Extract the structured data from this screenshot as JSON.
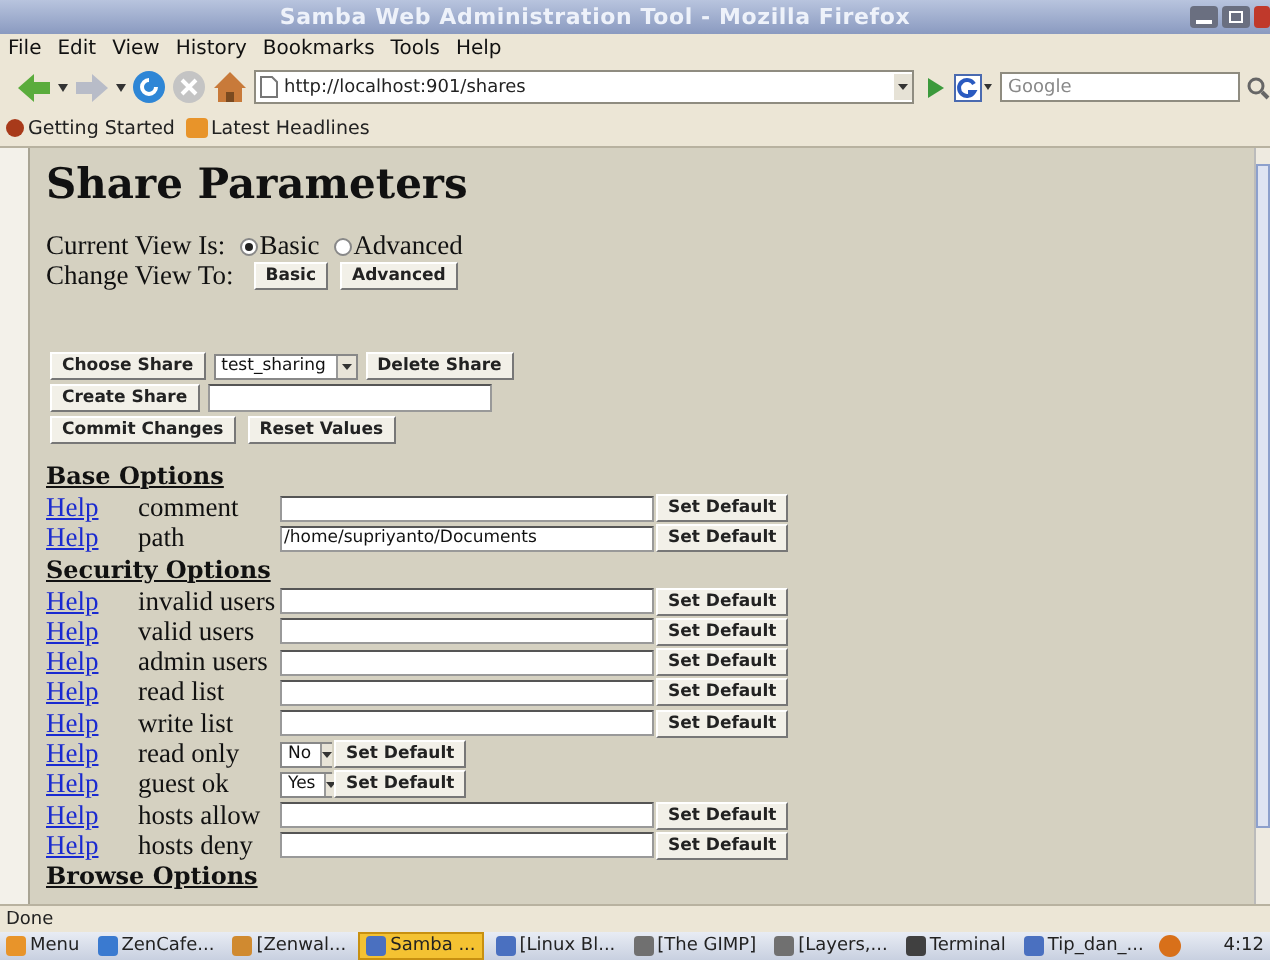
{
  "window": {
    "title": "Samba Web Administration Tool - Mozilla Firefox"
  },
  "menu": [
    "File",
    "Edit",
    "View",
    "History",
    "Bookmarks",
    "Tools",
    "Help"
  ],
  "address": {
    "value": "http://localhost:901/shares"
  },
  "search": {
    "placeholder": "Google"
  },
  "bookmarks": [
    "Getting Started",
    "Latest Headlines"
  ],
  "page": {
    "heading": "Share Parameters",
    "current_view_label": "Current View Is:",
    "view_options": [
      {
        "label": "Basic",
        "selected": true
      },
      {
        "label": "Advanced",
        "selected": false
      }
    ],
    "change_view_label": "Change View To:",
    "view_buttons": [
      "Basic",
      "Advanced"
    ],
    "choose_share_button": "Choose Share",
    "share_select": {
      "value": "test_sharing"
    },
    "delete_button": "Delete Share",
    "create_button": "Create Share",
    "commit_button": "Commit Changes",
    "reset_button": "Reset Values",
    "sections": [
      {
        "title": "Base Options",
        "params": [
          {
            "help": "Help",
            "name": "comment",
            "kind": "text",
            "button": "Set Default"
          },
          {
            "help": "Help",
            "name": "path",
            "kind": "text",
            "value": "/home/supriyanto/Documents",
            "button": "Set Default"
          }
        ]
      },
      {
        "title": "Security Options",
        "params": [
          {
            "help": "Help",
            "name": "invalid users",
            "kind": "text",
            "button": "Set Default"
          },
          {
            "help": "Help",
            "name": "valid users",
            "kind": "text",
            "button": "Set Default"
          },
          {
            "help": "Help",
            "name": "admin users",
            "kind": "text",
            "button": "Set Default"
          },
          {
            "help": "Help",
            "name": "read list",
            "kind": "text",
            "button": "Set Default"
          },
          {
            "help": "Help",
            "name": "write list",
            "kind": "text",
            "button": "Set Default"
          },
          {
            "help": "Help",
            "name": "read only",
            "kind": "select",
            "value": "No",
            "button": "Set Default"
          },
          {
            "help": "Help",
            "name": "guest ok",
            "kind": "select",
            "value": "Yes",
            "button": "Set Default"
          },
          {
            "help": "Help",
            "name": "hosts allow",
            "kind": "text",
            "button": "Set Default"
          },
          {
            "help": "Help",
            "name": "hosts deny",
            "kind": "text",
            "button": "Set Default"
          }
        ]
      },
      {
        "title": "Browse Options"
      }
    ]
  },
  "status_bar": "Done",
  "taskbar": {
    "items": [
      {
        "label": "Menu",
        "selected": false
      },
      {
        "label": "ZenCafe...",
        "selected": false
      },
      {
        "label": "[Zenwal...",
        "selected": false
      },
      {
        "label": "Samba ...",
        "selected": true
      },
      {
        "label": "[Linux Bl...",
        "selected": false
      },
      {
        "label": "[The GIMP]",
        "selected": false
      },
      {
        "label": "[Layers,...",
        "selected": false
      },
      {
        "label": "Terminal",
        "selected": false
      },
      {
        "label": "Tip_dan_...",
        "selected": false
      }
    ],
    "clock": "4:12"
  }
}
